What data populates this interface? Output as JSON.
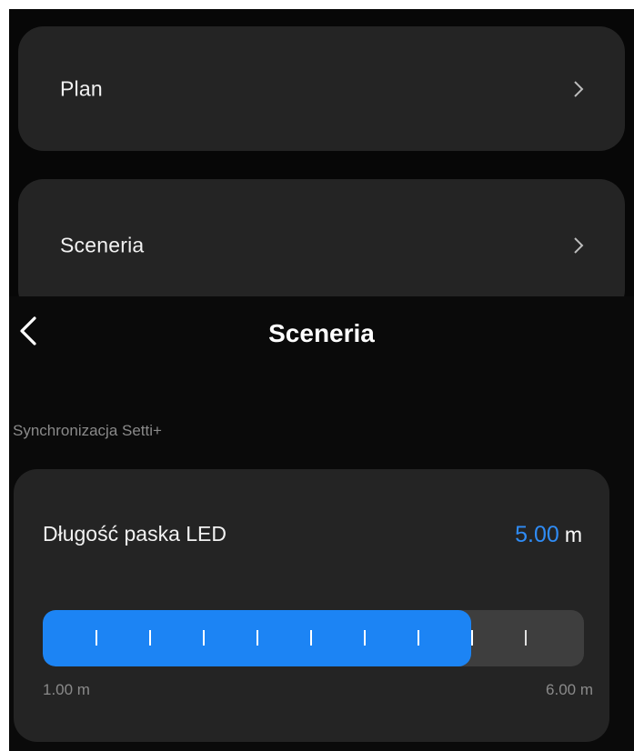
{
  "menu": {
    "items": [
      {
        "label": "Plan",
        "icon": "chevron-right-icon"
      },
      {
        "label": "Sceneria",
        "icon": "chevron-right-icon"
      }
    ]
  },
  "header": {
    "title": "Sceneria",
    "back_icon": "chevron-left-icon"
  },
  "section": {
    "label": "Synchronizacja Setti+"
  },
  "led_length": {
    "title": "Długość paska LED",
    "value": "5.00",
    "unit": "m",
    "min_label": "1.00 m",
    "max_label": "6.00 m",
    "min": 1.0,
    "max": 6.0,
    "current": 5.0,
    "tick_count": 9
  },
  "colors": {
    "accent": "#1c84f4",
    "value_text": "#2f8cf6",
    "card_bg": "#242424",
    "page_bg": "#0a0a0a"
  }
}
